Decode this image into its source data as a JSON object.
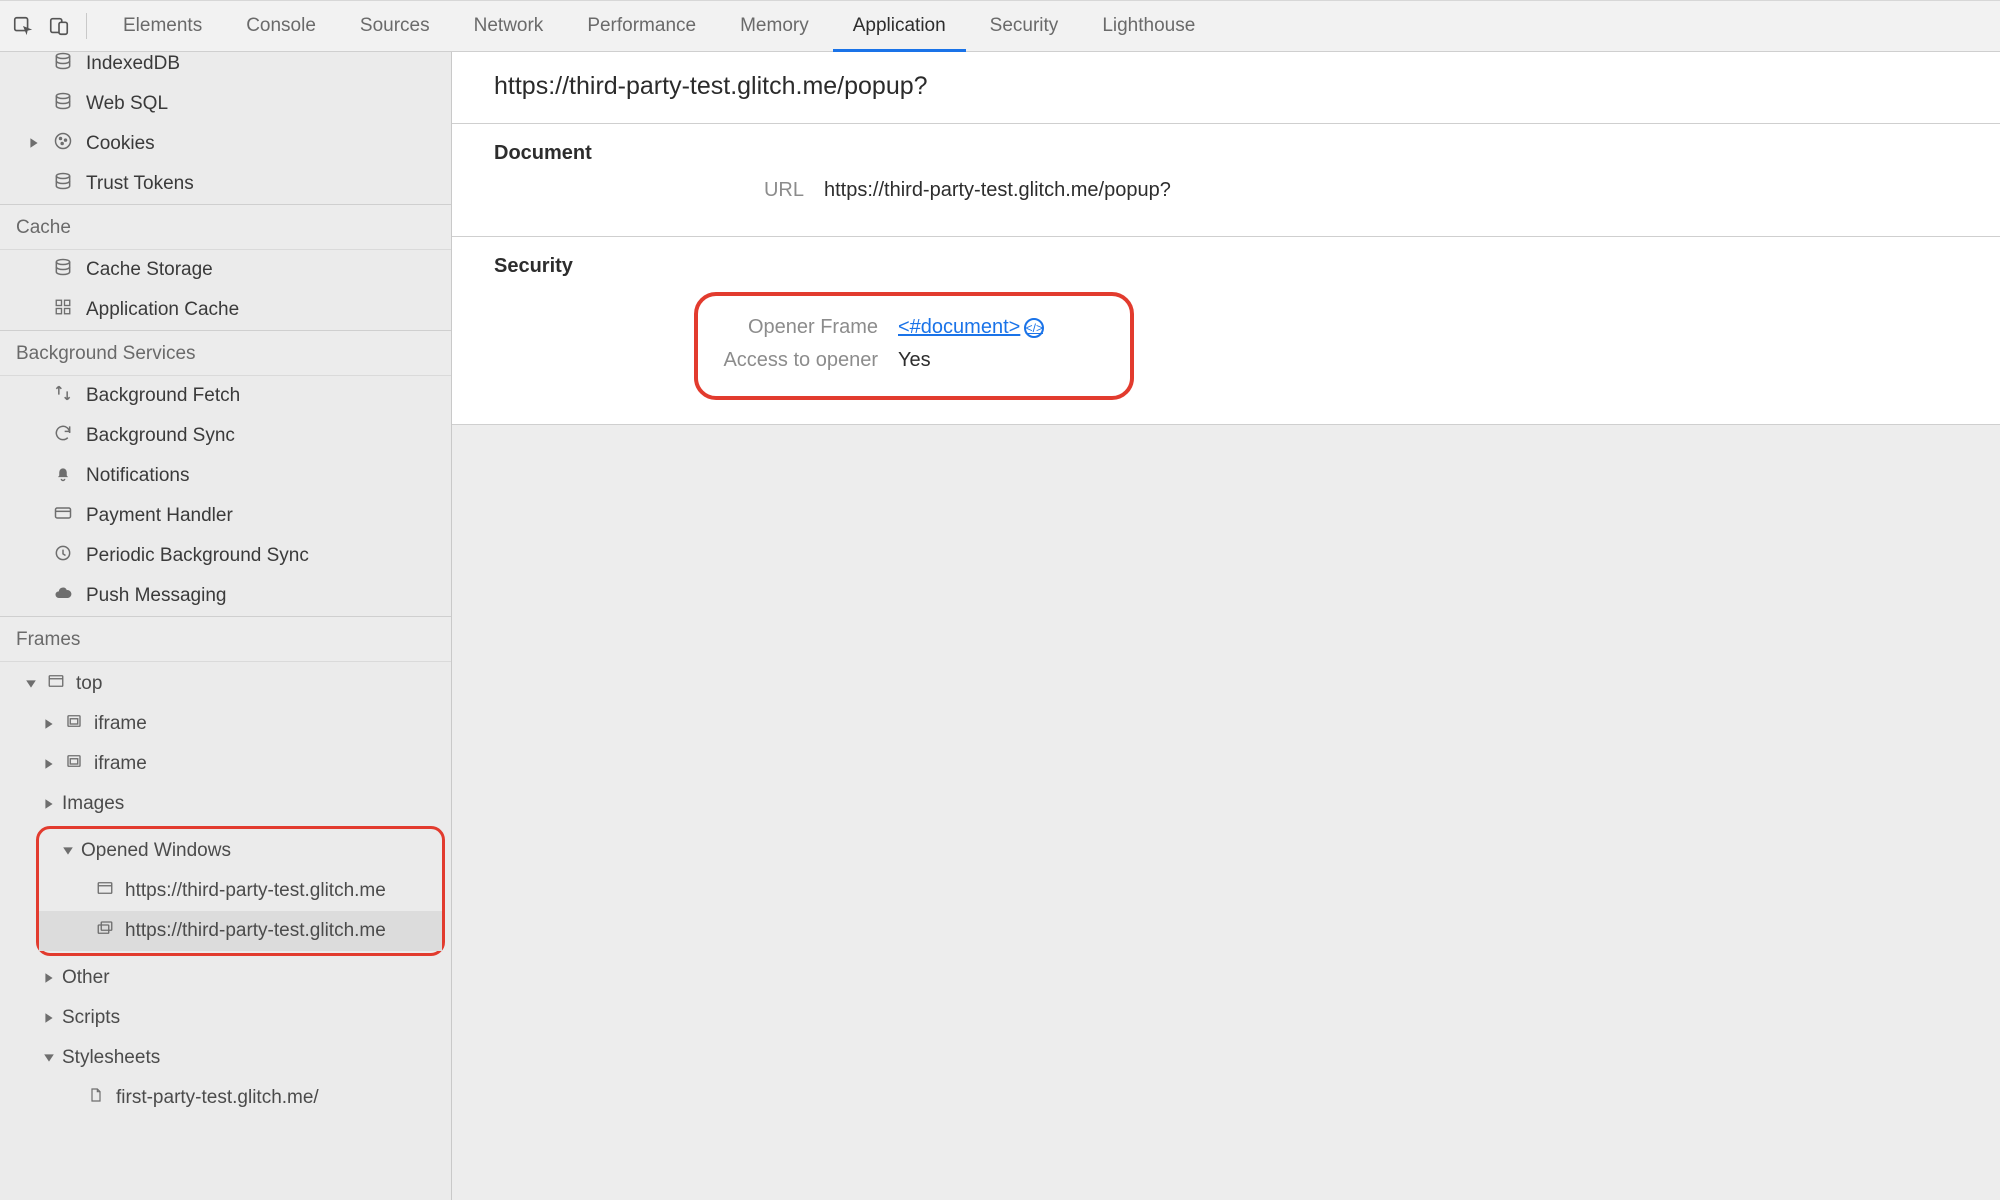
{
  "tabs": {
    "elements": "Elements",
    "console": "Console",
    "sources": "Sources",
    "network": "Network",
    "performance": "Performance",
    "memory": "Memory",
    "application": "Application",
    "security": "Security",
    "lighthouse": "Lighthouse"
  },
  "sidebar": {
    "storage": {
      "indexeddb": "IndexedDB",
      "websql": "Web SQL",
      "cookies": "Cookies",
      "trust_tokens": "Trust Tokens"
    },
    "cache_heading": "Cache",
    "cache": {
      "cache_storage": "Cache Storage",
      "application_cache": "Application Cache"
    },
    "bg_heading": "Background Services",
    "bg": {
      "background_fetch": "Background Fetch",
      "background_sync": "Background Sync",
      "notifications": "Notifications",
      "payment_handler": "Payment Handler",
      "periodic_background_sync": "Periodic Background Sync",
      "push_messaging": "Push Messaging"
    },
    "frames_heading": "Frames",
    "frames": {
      "top": "top",
      "iframe1": "iframe",
      "iframe2": "iframe",
      "images": "Images",
      "opened_windows": "Opened Windows",
      "ow1": "https://third-party-test.glitch.me",
      "ow2": "https://third-party-test.glitch.me",
      "other": "Other",
      "scripts": "Scripts",
      "stylesheets": "Stylesheets",
      "ss1": "first-party-test.glitch.me/"
    }
  },
  "main": {
    "title": "https://third-party-test.glitch.me/popup?",
    "document": {
      "section": "Document",
      "url_label": "URL",
      "url_value": "https://third-party-test.glitch.me/popup?"
    },
    "security": {
      "section": "Security",
      "opener_frame_label": "Opener Frame",
      "opener_frame_value": "<#document>",
      "access_label": "Access to opener",
      "access_value": "Yes"
    }
  }
}
